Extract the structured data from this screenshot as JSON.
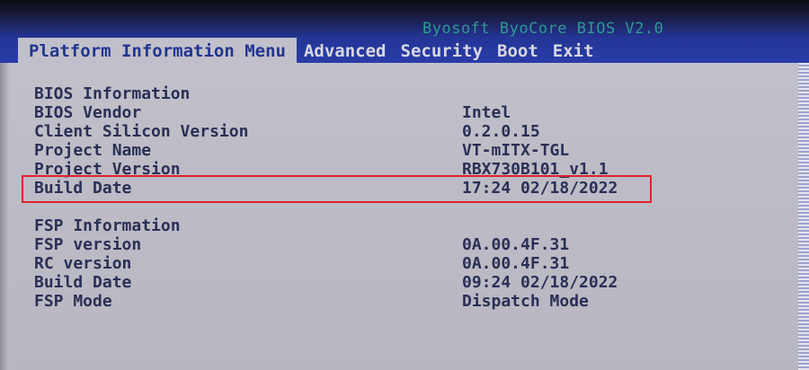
{
  "header": {
    "bios_title": "Byosoft ByoCore BIOS V2.0"
  },
  "menu": {
    "items": [
      {
        "label": "Platform Information Menu"
      },
      {
        "label": "Advanced"
      },
      {
        "label": "Security"
      },
      {
        "label": "Boot"
      },
      {
        "label": "Exit"
      }
    ],
    "active_index": 0
  },
  "bios_info": {
    "heading": "BIOS Information",
    "rows": [
      {
        "label": "BIOS Vendor",
        "value": "Intel"
      },
      {
        "label": "Client Silicon Version",
        "value": "0.2.0.15"
      },
      {
        "label": "Project Name",
        "value": "VT-mITX-TGL"
      },
      {
        "label": "Project Version",
        "value": "RBX730B101_v1.1"
      },
      {
        "label": "Build Date",
        "value": "17:24 02/18/2022"
      }
    ]
  },
  "fsp_info": {
    "heading": "FSP Information",
    "rows": [
      {
        "label": "FSP version",
        "value": "0A.00.4F.31"
      },
      {
        "label": "RC version",
        "value": "0A.00.4F.31"
      },
      {
        "label": "Build Date",
        "value": "09:24 02/18/2022"
      },
      {
        "label": "FSP Mode",
        "value": "Dispatch Mode"
      }
    ]
  },
  "colors": {
    "header_blue": "#2a3ca8",
    "body_gray": "#c1c0ca",
    "text_navy": "#2a2f55",
    "title_teal": "#2f9a93",
    "highlight_red": "#e2222c"
  }
}
